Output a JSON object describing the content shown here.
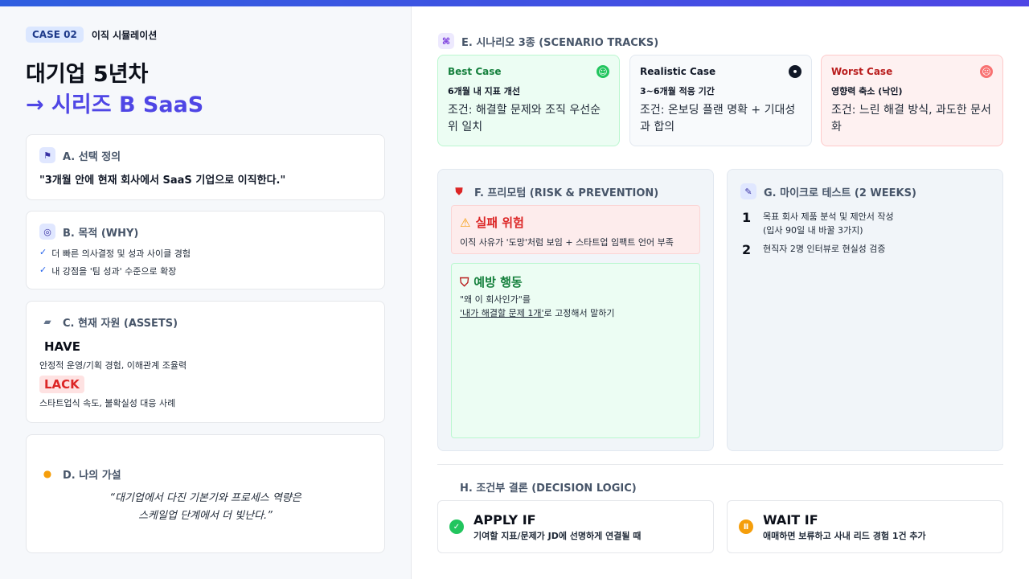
{
  "header": {
    "case_badge": "CASE 02",
    "case_subtitle": "이직 시뮬레이션",
    "title_line1": "대기업 5년차",
    "title_line2": "→ 시리즈 B SaaS"
  },
  "sections": {
    "a": {
      "heading": "A. 선택 정의",
      "icon": "flag-icon",
      "quote": "\"3개월 안에 현재 회사에서 SaaS 기업으로 이직한다.\""
    },
    "b": {
      "heading": "B. 목적 (WHY)",
      "icon": "target-icon",
      "items": [
        "더 빠른 의사결정 및 성과 사이클 경험",
        "내 강점을 '팀 성과' 수준으로 확장"
      ]
    },
    "c": {
      "heading": "C. 현재 자원 (ASSETS)",
      "icon": "toolbox-icon",
      "have_label": "HAVE",
      "have_text": "안정적 운영/기획 경험, 이해관계 조율력",
      "lack_label": "LACK",
      "lack_text": "스타트업식 속도, 불확실성 대응 사례"
    },
    "d": {
      "heading": "D. 나의 가설",
      "icon": "lightbulb-icon",
      "hypothesis_line1": "“대기업에서 다진 기본기와 프로세스 역량은",
      "hypothesis_line2": "스케일업 단계에서 더 빛난다.”"
    },
    "e": {
      "heading": "E. 시나리오 3종 (SCENARIO TRACKS)",
      "icon": "binoculars-icon",
      "cards": [
        {
          "title": "Best Case",
          "subtitle": "6개월 내 지표 개선",
          "body": "조건: 해결할 문제와 조직 우선순위 일치",
          "face": "smile-icon",
          "color": "#15803d",
          "face_color": "#22c55e"
        },
        {
          "title": "Realistic Case",
          "subtitle": "3~6개월 적응 기간",
          "body": "조건: 온보딩 플랜 명확 + 기대성과 합의",
          "face": "neutral-face-icon",
          "color": "#0b0f19",
          "face_color": "#111827"
        },
        {
          "title": "Worst Case",
          "subtitle": "영향력 축소 (낙인)",
          "body": "조건: 느린 해결 방식, 과도한 문서화",
          "face": "frown-icon",
          "color": "#b91c1c",
          "face_color": "#f87171"
        }
      ]
    },
    "f": {
      "heading": "F. 프리모텀 (RISK & PREVENTION)",
      "icon": "shield-icon",
      "risk_title": "실패 위험",
      "risk_text": "이직 사유가 '도망'처럼 보임 + 스타트업 임팩트 언어 부족",
      "prevent_title": "예방 행동",
      "prevent_line1": "\"왜 이 회사인가\"를",
      "prevent_line2_underlined": "'내가 해결할 문제 1개'",
      "prevent_line2_rest": "로 고정해서 말하기"
    },
    "g": {
      "heading": "G. 마이크로 테스트 (2 WEEKS)",
      "icon": "pencil-icon",
      "tests": [
        {
          "num": "1",
          "line1": "목표 회사 제품 분석 및 제안서 작성",
          "line2": "(입사 90일 내 바꿀 3가지)"
        },
        {
          "num": "2",
          "line1": "현직자 2명 인터뷰로 현실성 검증",
          "line2": ""
        }
      ]
    },
    "h": {
      "heading": "H. 조건부 결론 (DECISION LOGIC)",
      "apply_title": "APPLY IF",
      "apply_text": "기여할 지표/문제가 JD에 선명하게 연결될 때",
      "wait_title": "WAIT IF",
      "wait_text": "애매하면 보류하고 사내 리드 경험 1건 추가"
    }
  },
  "colors": {
    "accent": "#4f46e5",
    "risk": "#dc2626",
    "prevent": "#15803d",
    "apply": "#22c55e",
    "wait": "#f59e0b"
  }
}
